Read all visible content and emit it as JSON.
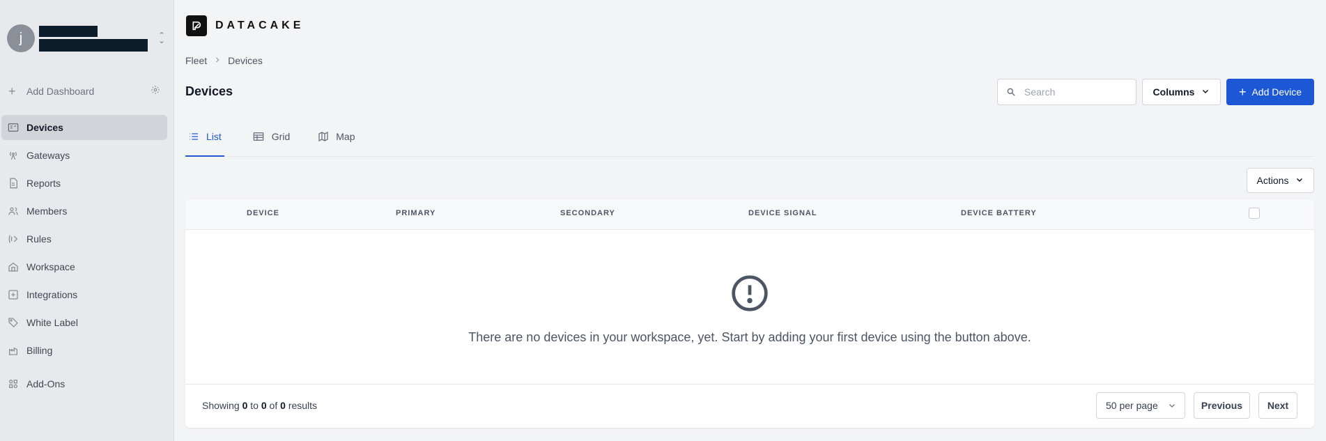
{
  "sidebar": {
    "workspace": {
      "avatar_initial": "j"
    },
    "add_dashboard_label": "Add Dashboard",
    "items": [
      {
        "label": "Devices",
        "icon": "devices-icon",
        "active": true
      },
      {
        "label": "Gateways",
        "icon": "gateway-icon"
      },
      {
        "label": "Reports",
        "icon": "report-icon"
      },
      {
        "label": "Members",
        "icon": "members-icon"
      },
      {
        "label": "Rules",
        "icon": "rules-icon"
      },
      {
        "label": "Workspace",
        "icon": "workspace-icon"
      },
      {
        "label": "Integrations",
        "icon": "integrations-icon"
      },
      {
        "label": "White Label",
        "icon": "tag-icon"
      },
      {
        "label": "Billing",
        "icon": "billing-icon"
      },
      {
        "label": "Add-Ons",
        "icon": "addons-icon"
      }
    ]
  },
  "brand": {
    "name": "DATACAKE"
  },
  "breadcrumb": [
    "Fleet",
    "Devices"
  ],
  "page": {
    "title": "Devices"
  },
  "toolbar": {
    "search_placeholder": "Search",
    "columns_label": "Columns",
    "add_device_label": "Add Device",
    "actions_label": "Actions"
  },
  "tabs": [
    {
      "label": "List",
      "icon": "list-icon",
      "active": true
    },
    {
      "label": "Grid",
      "icon": "table-icon"
    },
    {
      "label": "Map",
      "icon": "map-icon"
    }
  ],
  "table": {
    "columns": [
      "DEVICE",
      "PRIMARY",
      "SECONDARY",
      "DEVICE SIGNAL",
      "DEVICE BATTERY"
    ],
    "empty_message": "There are no devices in your workspace, yet. Start by adding your first device using the button above."
  },
  "pagination": {
    "showing_prefix": "Showing",
    "from": "0",
    "to_word": "to",
    "to": "0",
    "of_word": "of",
    "total": "0",
    "results_word": "results",
    "per_page": "50 per page",
    "previous_label": "Previous",
    "next_label": "Next"
  },
  "colors": {
    "accent": "#1c57d6",
    "sidebar_bg": "#e8e9ec",
    "active_item_bg": "#d2d4d9"
  }
}
